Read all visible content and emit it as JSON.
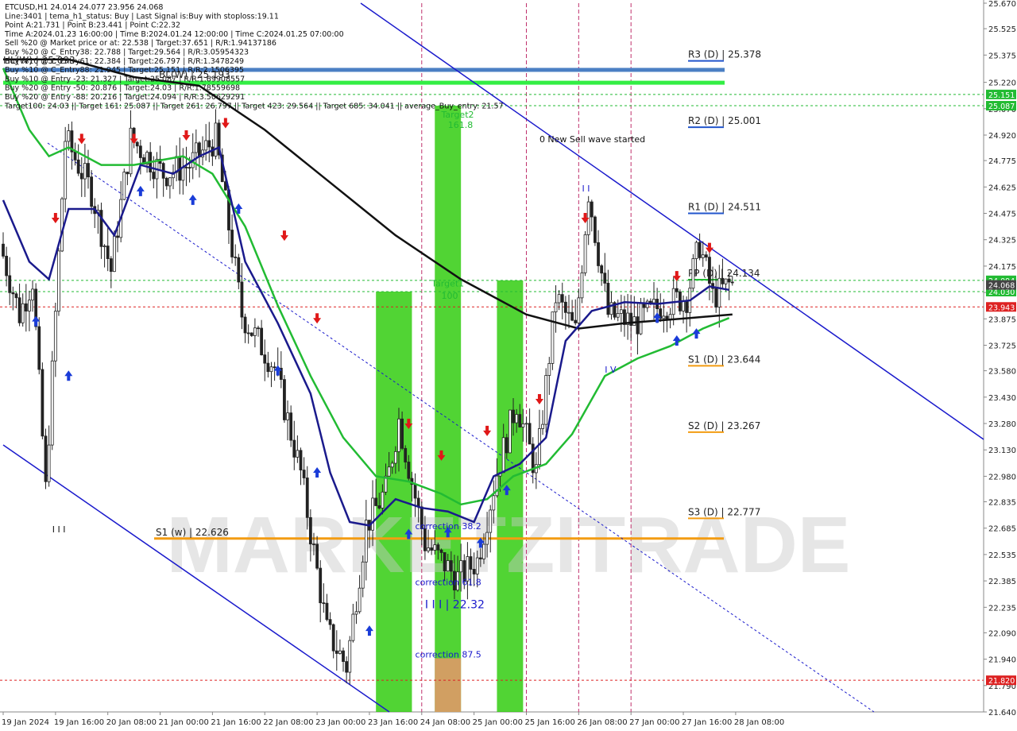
{
  "header": {
    "lines": [
      "ETCUSD,H1  24.014 24.077 23.956 24.068",
      "Line:3401 | tema_h1_status: Buy | Last Signal is:Buy with stoploss:19.11",
      "Point A:21.731 | Point B:23.441 | Point C:22.32",
      "Time A:2024.01.23 16:00:00 | Time B:2024.01.24 12:00:00 | Time C:2024.01.25 07:00:00",
      "Sell %20 @ Market price or at: 22.538 | Target:37.651 | R/R:1.94137186",
      "Buy %20 @ C_Entry38: 22.788 | Target:29.564 | R/R:3.05954323",
      "Buy %10 @ C_Entry61: 22.384 | Target:26.797 | R/R:1.3478249",
      "Buy %10 @ C_Entry88: 21.945 | Target:25.151 | R/R:2.1506395",
      "Buy %10 @ Entry -23: 21.327 | Target:25.087 | R/R:1.69908557",
      "Buy %20 @ Entry -50: 20.876 | Target:24.03 | R/R:1.78559698",
      "Buy %20 @ Entry -88: 20.216 | Target:24.094 | R/R:3.50629291",
      "Target100: 24.03 || Target 161: 25.087 || Target 261: 26.797 || Target 423: 29.564 || Target 685: 34.041 || average_Buy_entry: 21.57"
    ],
    "overlay_text": "HL(W) | 25.093",
    "overlay_text2": "BL(W) | 25.193"
  },
  "chart_data": {
    "type": "candlestick",
    "symbol": "ETCUSD,H1",
    "ohlc_last": {
      "open": 24.014,
      "high": 24.077,
      "low": 23.956,
      "close": 24.068
    },
    "ylim": [
      21.64,
      25.67
    ],
    "y_ticks": [
      25.67,
      25.525,
      25.375,
      25.22,
      25.07,
      24.92,
      24.775,
      24.625,
      24.475,
      24.325,
      24.175,
      24.025,
      23.875,
      23.725,
      23.58,
      23.43,
      23.28,
      23.13,
      22.98,
      22.835,
      22.685,
      22.535,
      22.385,
      22.235,
      22.09,
      21.94,
      21.79,
      21.64
    ],
    "y_tick_labels": [
      "25.670",
      "25.525",
      "25.375",
      "25.220",
      "25.070",
      "24.920",
      "24.775",
      "24.625",
      "24.475",
      "24.325",
      "24.175",
      "24.025",
      "23.875",
      "23.725",
      "23.580",
      "23.430",
      "23.280",
      "23.130",
      "22.980",
      "22.835",
      "22.685",
      "22.535",
      "22.385",
      "22.235",
      "22.090",
      "21.940",
      "21.790",
      "21.640"
    ],
    "x_labels": [
      "19 Jan 2024",
      "19 Jan 16:00",
      "20 Jan 08:00",
      "21 Jan 00:00",
      "21 Jan 16:00",
      "22 Jan 08:00",
      "23 Jan 00:00",
      "23 Jan 16:00",
      "24 Jan 08:00",
      "25 Jan 00:00",
      "25 Jan 16:00",
      "26 Jan 08:00",
      "27 Jan 00:00",
      "27 Jan 16:00",
      "28 Jan 08:00"
    ],
    "x_range_hours": [
      0,
      225
    ],
    "x_label_hours": [
      0,
      16,
      32,
      48,
      64,
      80,
      96,
      112,
      128,
      144,
      160,
      176,
      192,
      208,
      224
    ],
    "daily_separators_hours": [
      128,
      160,
      176,
      192
    ],
    "price_badges": [
      {
        "price": 25.151,
        "label": "25.151",
        "color": "#22bb33"
      },
      {
        "price": 25.087,
        "label": "25.087",
        "color": "#22bb33"
      },
      {
        "price": 24.094,
        "label": "24.094",
        "color": "#22bb33"
      },
      {
        "price": 24.03,
        "label": "24.030",
        "color": "#22bb33"
      },
      {
        "price": 23.943,
        "label": "23.943",
        "color": "#dd2222"
      },
      {
        "price": 21.82,
        "label": "21.820",
        "color": "#dd2222"
      }
    ],
    "current_price": {
      "price": 24.068,
      "label": "24.068",
      "color": "#444444"
    },
    "pivot_levels": [
      {
        "label": "R3 (D) | 25.378",
        "price": 25.378,
        "color": "#2255cc"
      },
      {
        "label": "R2 (D) | 25.001",
        "price": 25.001,
        "color": "#2255cc"
      },
      {
        "label": "R1 (D) | 24.511",
        "price": 24.511,
        "color": "#2255cc"
      },
      {
        "label": "PP (D) | 24.134",
        "price": 24.134,
        "color": "#22bb33"
      },
      {
        "label": "S1 (D) | 23.644",
        "price": 23.644,
        "color": "#f39c12"
      },
      {
        "label": "S2 (D) | 23.267",
        "price": 23.267,
        "color": "#f39c12"
      },
      {
        "label": "S3 (D) | 22.777",
        "price": 22.777,
        "color": "#f39c12"
      }
    ],
    "weekly_levels": [
      {
        "label": "S1 (w) | 22.626",
        "price": 22.626,
        "color": "#f39c12"
      }
    ],
    "annotations": [
      {
        "text": "0 New Sell wave started",
        "hour": 164,
        "price": 24.88,
        "color": "#111111"
      },
      {
        "text": "Target2",
        "hour": 134,
        "price": 25.02,
        "color": "#22bb33"
      },
      {
        "text": "161.8",
        "hour": 136,
        "price": 24.96,
        "color": "#22bb33"
      },
      {
        "text": "Target1",
        "hour": 131,
        "price": 24.06,
        "color": "#22bb33"
      },
      {
        "text": "100",
        "hour": 134,
        "price": 23.99,
        "color": "#22bb33"
      },
      {
        "text": "correction 38.2",
        "hour": 126,
        "price": 22.68,
        "color": "#1a1acc"
      },
      {
        "text": "correction 61.8",
        "hour": 126,
        "price": 22.36,
        "color": "#1a1acc"
      },
      {
        "text": "I I I | 22.32",
        "hour": 129,
        "price": 22.23,
        "color": "#1a1acc"
      },
      {
        "text": "correction 87.5",
        "hour": 126,
        "price": 21.95,
        "color": "#1a1acc"
      },
      {
        "text": "I I I",
        "hour": 15,
        "price": 22.66,
        "color": "#111111"
      },
      {
        "text": "I I",
        "hour": 177,
        "price": 24.6,
        "color": "#1a1acc"
      },
      {
        "text": "I V",
        "hour": 184,
        "price": 23.57,
        "color": "#1a1acc"
      }
    ],
    "wave_zones": [
      {
        "from_hour": 114,
        "to_hour": 125,
        "low": 21.64,
        "high": 24.03,
        "color": "#33cc11"
      },
      {
        "from_hour": 132,
        "to_hour": 140,
        "low": 21.64,
        "high": 25.087,
        "color": "#33cc11"
      },
      {
        "from_hour": 132,
        "to_hour": 140,
        "low": 21.64,
        "high": 21.945,
        "color": "#e8956b"
      },
      {
        "from_hour": 151,
        "to_hour": 159,
        "low": 21.64,
        "high": 24.094,
        "color": "#33cc11"
      }
    ],
    "horizontal_bars": [
      {
        "price": 25.293,
        "color": "#4b7fc4"
      },
      {
        "price": 25.22,
        "color": "#33ee44"
      }
    ],
    "watermark": "MARKETZITRADE"
  }
}
